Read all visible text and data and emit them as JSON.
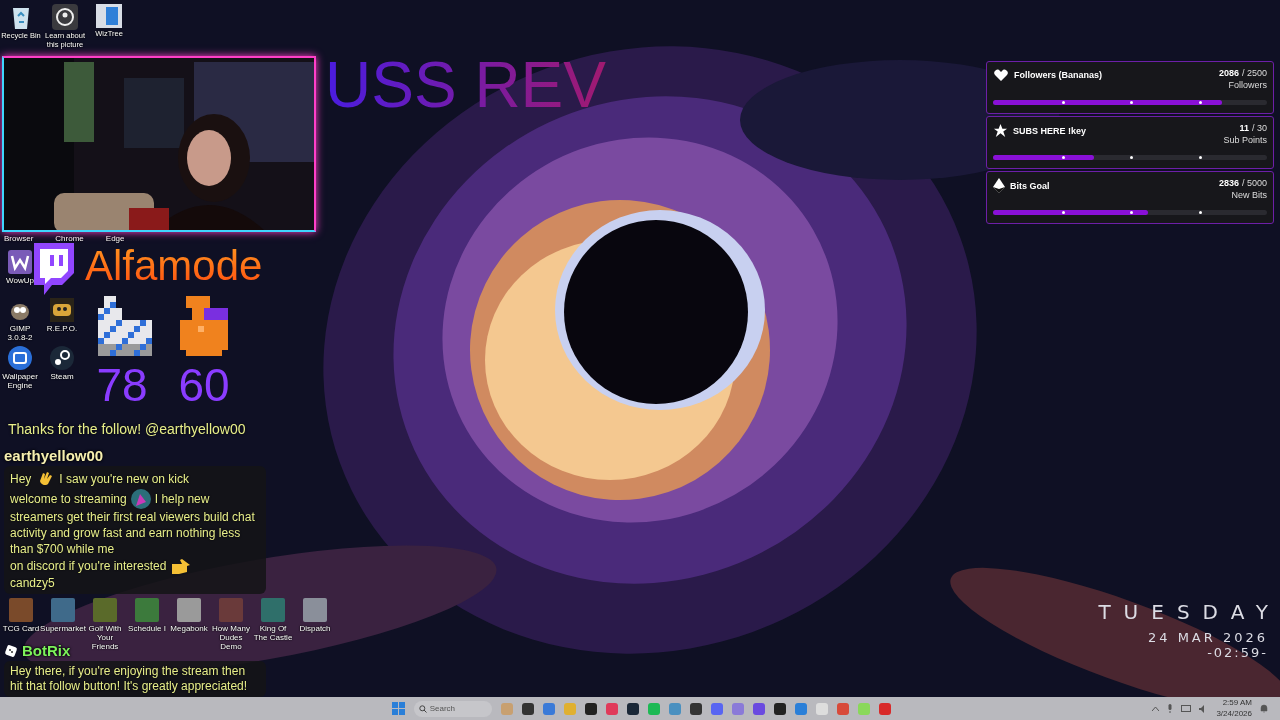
{
  "desktop": {
    "top_icons": [
      {
        "label": "Recycle Bin",
        "kind": "bin"
      },
      {
        "label": "Learn about this picture",
        "kind": "learn"
      },
      {
        "label": "WizTree",
        "kind": "wiztree"
      }
    ],
    "hidden_labels": [
      "Browser",
      "Chrome",
      "Edge"
    ],
    "side_icons": [
      {
        "label": "WowUp",
        "kind": "wowup"
      },
      {
        "label": "GIMP 3.0.8-2",
        "kind": "gimp"
      },
      {
        "label": "R.E.P.O.",
        "kind": "repo"
      },
      {
        "label": "Wallpaper Engine",
        "kind": "wallpaper"
      },
      {
        "label": "Steam",
        "kind": "steam"
      }
    ],
    "game_icons": [
      {
        "label": "TCG Card",
        "color": "#7a4a2a"
      },
      {
        "label": "Supermarket",
        "color": "#3f6a8a"
      },
      {
        "label": "Golf With Your Friends",
        "color": "#5a6a2a"
      },
      {
        "label": "Schedule I",
        "color": "#3c7a3c"
      },
      {
        "label": "Megabonk",
        "color": "#9a9a9a"
      },
      {
        "label": "How Many Dudes Demo",
        "color": "#6a3a3a"
      },
      {
        "label": "King Of The Castle",
        "color": "#2f6f6a"
      },
      {
        "label": "Dispatch",
        "color": "#8a8f9a"
      }
    ]
  },
  "stream": {
    "title": "USS REV",
    "channel": "Alfamode",
    "counters": [
      {
        "kind": "boot",
        "count": "78"
      },
      {
        "kind": "bag",
        "count": "60"
      }
    ]
  },
  "chat": {
    "faded_line": "Thanks for the follow! @earthyellow00",
    "messages": [
      {
        "user": "earthyellow00",
        "color": "#f6efb0",
        "bot": false,
        "parts": [
          {
            "kind": "text",
            "text": "Hey"
          },
          {
            "kind": "wave"
          },
          {
            "kind": "text",
            "text": "I saw you're new on kick"
          },
          {
            "kind": "text",
            "text": "welcome to streaming"
          },
          {
            "kind": "party"
          },
          {
            "kind": "text",
            "text": "I help new"
          },
          {
            "kind": "text",
            "text": "streamers get their first real viewers build chat activity and grow fast and earn nothing less than $700 while me"
          },
          {
            "kind": "text",
            "text": "on discord if you're interested"
          },
          {
            "kind": "point"
          },
          {
            "kind": "line",
            "text": "candzy5"
          }
        ]
      },
      {
        "user": "BotRix",
        "color": "#7cf25b",
        "bot": true,
        "parts": [
          {
            "kind": "text",
            "text": "Hey there, if you're enjoying the stream then hit that follow button! It's greatly appreciated!"
          }
        ]
      }
    ]
  },
  "goals": [
    {
      "kind": "heart",
      "title": "Followers (Bananas)",
      "current": "2086",
      "target": "/ 2500",
      "unit": "Followers",
      "level": 0.834
    },
    {
      "kind": "star",
      "title": "SUBS HERE !key",
      "current": "11",
      "target": "/ 30",
      "unit": "Sub Points",
      "level": 0.367
    },
    {
      "kind": "gem",
      "title": "Bits Goal",
      "current": "2836",
      "target": "/ 5000",
      "unit": "New Bits",
      "level": 0.567
    }
  ],
  "clock": {
    "weekday": "TUESDAY",
    "date": "24 MAR 2026",
    "time": "-02:59-"
  },
  "taskbar": {
    "search": {
      "placeholder": "Search"
    },
    "time": "2:59 AM",
    "date": "3/24/2026"
  }
}
